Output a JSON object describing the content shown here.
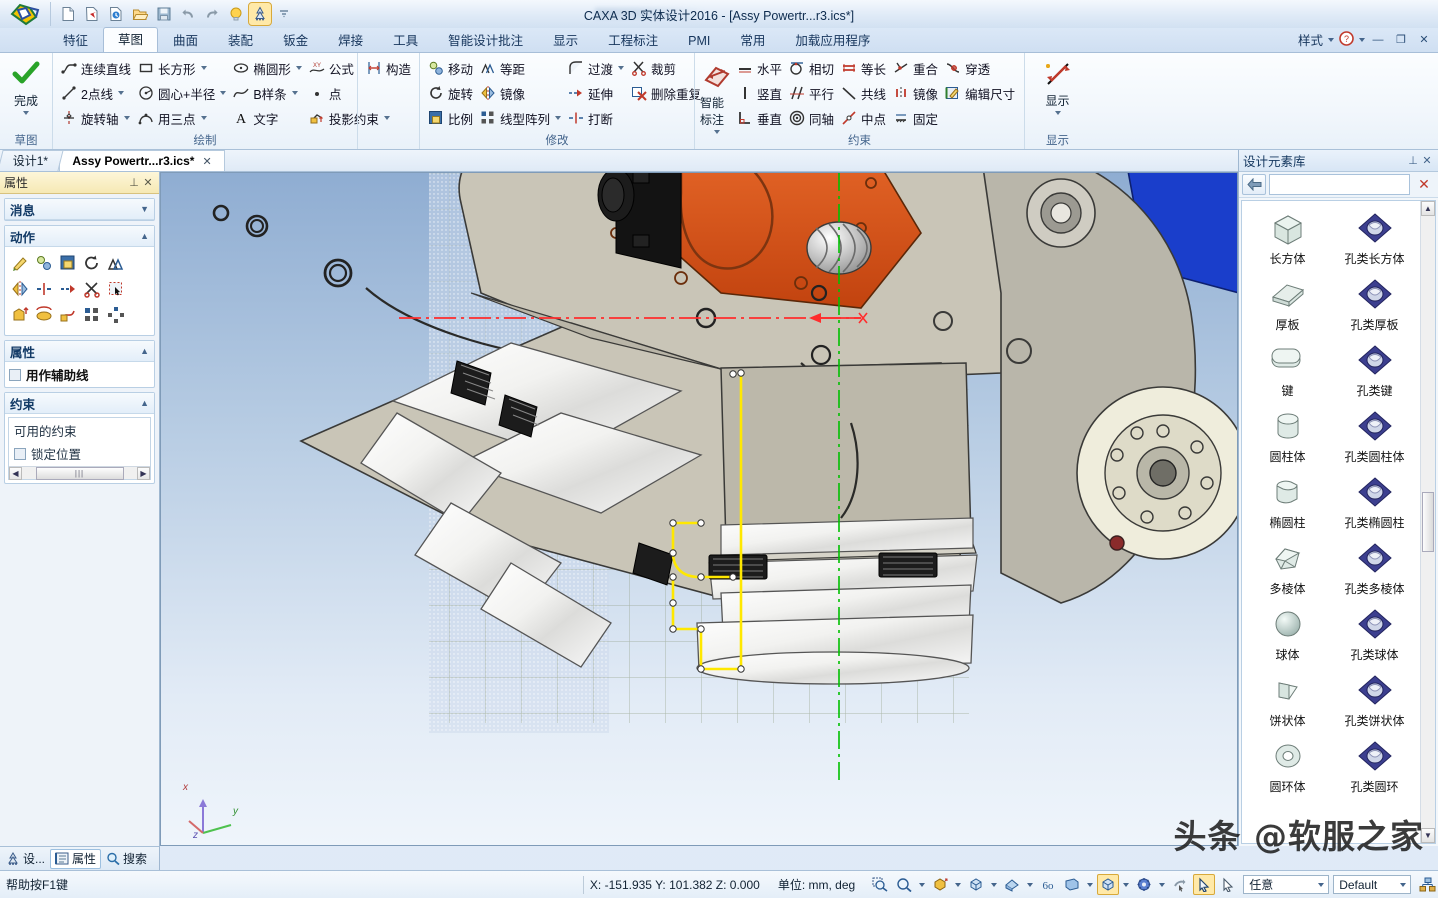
{
  "window": {
    "title": "CAXA 3D 实体设计2016 - [Assy Powertr...r3.ics*]",
    "minimize": "—",
    "restore": "❐",
    "close": "✕"
  },
  "quick_access": [
    {
      "name": "new-document-icon",
      "label": "新建"
    },
    {
      "name": "new-from-template-icon",
      "label": "新建模板"
    },
    {
      "name": "open-recent-icon",
      "label": "打开最近"
    },
    {
      "name": "open-folder-icon",
      "label": "打开"
    },
    {
      "name": "save-icon",
      "label": "保存"
    },
    {
      "name": "undo-icon",
      "label": "撤销"
    },
    {
      "name": "redo-icon",
      "label": "重做"
    },
    {
      "name": "smart-bulb-icon",
      "label": "智能"
    },
    {
      "name": "design-wizard-icon",
      "label": "设计向导"
    },
    {
      "name": "qat-overflow-icon",
      "label": "自定义快速访问工具栏"
    }
  ],
  "ribbon": {
    "tabs": [
      {
        "label": "特征",
        "active": false
      },
      {
        "label": "草图",
        "active": true
      },
      {
        "label": "曲面",
        "active": false
      },
      {
        "label": "装配",
        "active": false
      },
      {
        "label": "钣金",
        "active": false
      },
      {
        "label": "焊接",
        "active": false
      },
      {
        "label": "工具",
        "active": false
      },
      {
        "label": "智能设计批注",
        "active": false
      },
      {
        "label": "显示",
        "active": false
      },
      {
        "label": "工程标注",
        "active": false
      },
      {
        "label": "PMI",
        "active": false
      },
      {
        "label": "常用",
        "active": false
      },
      {
        "label": "加载应用程序",
        "active": false
      }
    ],
    "style_label": "样式",
    "help_label": "?",
    "groups": [
      {
        "title": "草图",
        "big_button": {
          "label": "完成",
          "icon": "green-check-icon",
          "has_dropdown": true
        }
      },
      {
        "title": "绘制",
        "columns": [
          [
            {
              "label": "连续直线",
              "icon": "polyline-icon",
              "dropdown": false
            },
            {
              "label": "2点线",
              "icon": "two-point-line-icon",
              "dropdown": true
            },
            {
              "label": "旋转轴",
              "icon": "revolve-axis-icon",
              "dropdown": true
            }
          ],
          [
            {
              "label": "长方形",
              "icon": "rectangle-icon",
              "dropdown": true
            },
            {
              "label": "圆心+半径",
              "icon": "circle-center-radius-icon",
              "dropdown": true
            },
            {
              "label": "用三点",
              "icon": "arc-three-point-icon",
              "dropdown": true
            }
          ],
          [
            {
              "label": "椭圆形",
              "icon": "ellipse-icon",
              "dropdown": true
            },
            {
              "label": "B样条",
              "icon": "bspline-icon",
              "dropdown": true
            },
            {
              "label": "文字",
              "icon": "text-icon",
              "dropdown": false
            }
          ],
          [
            {
              "label": "公式",
              "icon": "formula-curve-icon",
              "dropdown": false
            },
            {
              "label": "点",
              "icon": "point-icon",
              "dropdown": false
            },
            {
              "label": "投影约束",
              "icon": "project-constraint-icon",
              "dropdown": true
            }
          ]
        ]
      },
      {
        "title": "",
        "columns": [
          [
            {
              "label": "构造",
              "icon": "construction-geometry-icon",
              "dropdown": false
            }
          ]
        ]
      },
      {
        "title": "修改",
        "columns": [
          [
            {
              "label": "移动",
              "icon": "move-icon",
              "dropdown": false
            },
            {
              "label": "旋转",
              "icon": "rotate-icon",
              "dropdown": false
            },
            {
              "label": "比例",
              "icon": "scale-icon",
              "dropdown": false
            }
          ],
          [
            {
              "label": "等距",
              "icon": "offset-icon",
              "dropdown": false
            },
            {
              "label": "镜像",
              "icon": "mirror-icon",
              "dropdown": false
            },
            {
              "label": "线型阵列",
              "icon": "linear-pattern-icon",
              "dropdown": true
            }
          ],
          [
            {
              "label": "过渡",
              "icon": "fillet-icon",
              "dropdown": true
            },
            {
              "label": "延伸",
              "icon": "extend-icon",
              "dropdown": false
            },
            {
              "label": "打断",
              "icon": "break-icon",
              "dropdown": false
            }
          ],
          [
            {
              "label": "裁剪",
              "icon": "trim-scissors-icon",
              "dropdown": false
            },
            {
              "label": "删除重复",
              "icon": "delete-duplicate-icon",
              "dropdown": false
            }
          ]
        ]
      },
      {
        "title": "约束",
        "big_button": {
          "label": "智能标注",
          "icon": "smart-dimension-icon",
          "has_dropdown": true
        },
        "columns": [
          [
            {
              "label": "水平",
              "icon": "horizontal-constraint-icon",
              "dropdown": false
            },
            {
              "label": "竖直",
              "icon": "vertical-constraint-icon",
              "dropdown": false
            },
            {
              "label": "垂直",
              "icon": "perpendicular-constraint-icon",
              "dropdown": false
            }
          ],
          [
            {
              "label": "相切",
              "icon": "tangent-constraint-icon",
              "dropdown": false
            },
            {
              "label": "平行",
              "icon": "parallel-constraint-icon",
              "dropdown": false
            },
            {
              "label": "同轴",
              "icon": "concentric-constraint-icon",
              "dropdown": false
            }
          ],
          [
            {
              "label": "等长",
              "icon": "equal-length-constraint-icon",
              "dropdown": false
            },
            {
              "label": "共线",
              "icon": "collinear-constraint-icon",
              "dropdown": false
            },
            {
              "label": "中点",
              "icon": "midpoint-constraint-icon",
              "dropdown": false
            }
          ],
          [
            {
              "label": "重合",
              "icon": "coincident-constraint-icon",
              "dropdown": false
            },
            {
              "label": "镜像",
              "icon": "symmetry-constraint-icon",
              "dropdown": false
            },
            {
              "label": "固定",
              "icon": "fix-constraint-icon",
              "dropdown": false
            }
          ],
          [
            {
              "label": "穿透",
              "icon": "pierce-constraint-icon",
              "dropdown": false
            },
            {
              "label": "编辑尺寸",
              "icon": "edit-dimension-icon",
              "dropdown": false
            }
          ]
        ]
      },
      {
        "title": "显示",
        "big_button": {
          "label": "显示",
          "icon": "display-arrows-icon",
          "has_dropdown": true
        }
      }
    ]
  },
  "doc_tabs": [
    {
      "label": "设计1*",
      "active": false,
      "closable": false
    },
    {
      "label": "Assy Powertr...r3.ics*",
      "active": true,
      "closable": true
    }
  ],
  "left_panel": {
    "title": "属性",
    "pin": "⊥",
    "close": "✕",
    "sections": [
      {
        "title": "消息",
        "collapsed": true,
        "chevron": "▼"
      },
      {
        "title": "动作",
        "collapsed": false,
        "chevron": "▲",
        "icon_rows": [
          [
            "sketch-edit-icon",
            "move-icon",
            "scale-icon",
            "rotate-icon",
            "offset-icon"
          ],
          [
            "mirror-icon",
            "break-icon",
            "extend-icon",
            "trim-scissors-icon",
            "select-region-icon"
          ],
          [
            "extrude-icon",
            "revolve-icon",
            "sweep-icon",
            "linear-pattern-icon",
            "circular-pattern-icon"
          ]
        ]
      },
      {
        "title": "属性",
        "collapsed": false,
        "chevron": "▲",
        "checkbox": {
          "label": "用作辅助线",
          "checked": false
        }
      },
      {
        "title": "约束",
        "collapsed": false,
        "chevron": "▲",
        "list_label": "可用的约束",
        "list_item": {
          "label": "锁定位置",
          "checked": false
        }
      }
    ]
  },
  "right_panel": {
    "title": "设计元素库",
    "pin": "⊥",
    "close": "✕",
    "back_icon": "back-arrow-icon",
    "search_value": "",
    "close_icon": "red-x-icon",
    "items": [
      {
        "label": "长方体",
        "icon": "box-solid-icon",
        "kind": "solid"
      },
      {
        "label": "孔类长方体",
        "icon": "box-hole-icon",
        "kind": "hole"
      },
      {
        "label": "厚板",
        "icon": "slab-solid-icon",
        "kind": "solid"
      },
      {
        "label": "孔类厚板",
        "icon": "slab-hole-icon",
        "kind": "hole"
      },
      {
        "label": "键",
        "icon": "key-solid-icon",
        "kind": "solid"
      },
      {
        "label": "孔类键",
        "icon": "key-hole-icon",
        "kind": "hole"
      },
      {
        "label": "圆柱体",
        "icon": "cylinder-solid-icon",
        "kind": "solid"
      },
      {
        "label": "孔类圆柱体",
        "icon": "cylinder-hole-icon",
        "kind": "hole"
      },
      {
        "label": "椭圆柱",
        "icon": "elliptic-cylinder-solid-icon",
        "kind": "solid"
      },
      {
        "label": "孔类椭圆柱",
        "icon": "elliptic-cylinder-hole-icon",
        "kind": "hole"
      },
      {
        "label": "多棱体",
        "icon": "polyhedron-solid-icon",
        "kind": "solid"
      },
      {
        "label": "孔类多棱体",
        "icon": "polyhedron-hole-icon",
        "kind": "hole"
      },
      {
        "label": "球体",
        "icon": "sphere-solid-icon",
        "kind": "solid"
      },
      {
        "label": "孔类球体",
        "icon": "sphere-hole-icon",
        "kind": "hole"
      },
      {
        "label": "饼状体",
        "icon": "wedge-solid-icon",
        "kind": "solid"
      },
      {
        "label": "孔类饼状体",
        "icon": "wedge-hole-icon",
        "kind": "hole"
      },
      {
        "label": "圆环体",
        "icon": "torus-solid-icon",
        "kind": "solid"
      },
      {
        "label": "孔类圆环",
        "icon": "torus-hole-icon",
        "kind": "hole"
      }
    ]
  },
  "bottom_tabs": [
    {
      "label": "设...",
      "icon": "design-tree-icon",
      "active": false
    },
    {
      "label": "属性",
      "icon": "properties-icon",
      "active": true
    },
    {
      "label": "搜索",
      "icon": "search-icon",
      "active": false
    }
  ],
  "status_bar": {
    "help_text": "帮助按F1键",
    "coordinates": "X: -151.935 Y: 101.382 Z: 0.000",
    "unit_label": "单位: mm, deg",
    "tools": [
      {
        "name": "zoom-window-icon",
        "dropdown": false,
        "selected": false
      },
      {
        "name": "zoom-all-icon",
        "dropdown": true,
        "selected": false
      },
      {
        "name": "render-shaded-icon",
        "dropdown": true,
        "selected": false
      },
      {
        "name": "view-cube-icon",
        "dropdown": true,
        "selected": false
      },
      {
        "name": "view-orientation-icon",
        "dropdown": true,
        "selected": false
      },
      {
        "name": "perspective-icon",
        "dropdown": false,
        "selected": false
      },
      {
        "name": "field-of-view-icon",
        "dropdown": true,
        "selected": false
      },
      {
        "name": "shading-mode-icon",
        "dropdown": true,
        "selected": true
      },
      {
        "name": "render-style-icon",
        "dropdown": true,
        "selected": false
      },
      {
        "name": "drag-mode-icon",
        "dropdown": false,
        "selected": false
      },
      {
        "name": "select-arrow-icon",
        "dropdown": false,
        "selected": true
      },
      {
        "name": "pick-filter-arrow-icon",
        "dropdown": false,
        "selected": false
      }
    ],
    "filter_combo": {
      "value": "任意"
    },
    "style_combo": {
      "value": "Default"
    },
    "tree_icon": "assembly-tree-icon"
  },
  "viewport": {
    "axis_x_label": "x",
    "axis_y_label": "y",
    "axis_z_label": "z",
    "colors": {
      "sketch_active": "#ffe800",
      "centerline": "#ff2d2d",
      "axis_green": "#00c000",
      "part_orange": "#d4541e",
      "part_grey": "#c8c4b6",
      "part_blue": "#1b3fcf"
    }
  },
  "watermark": "头条 @软服之家"
}
